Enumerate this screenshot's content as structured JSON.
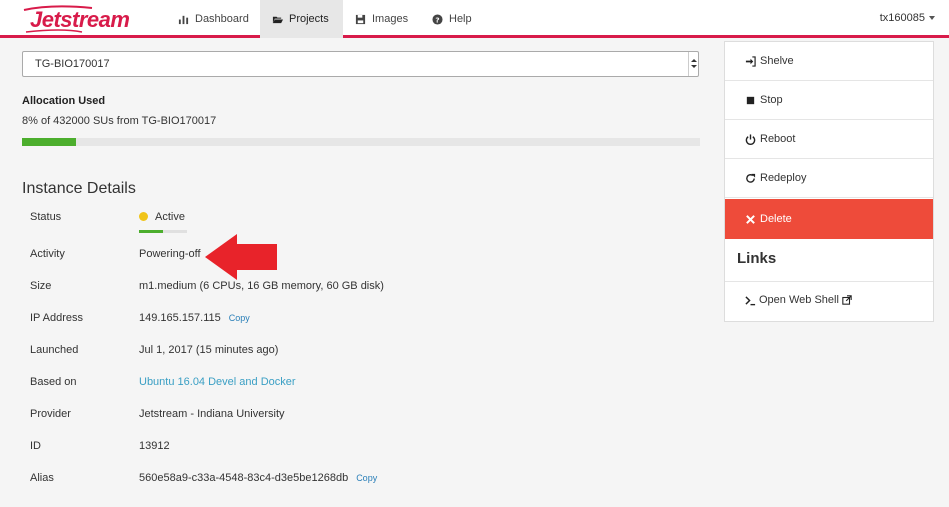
{
  "nav": {
    "logo_text": "Jetstream",
    "items": [
      {
        "label": "Dashboard",
        "icon": "bar-chart-icon"
      },
      {
        "label": "Projects",
        "icon": "folder-open-icon",
        "active": true
      },
      {
        "label": "Images",
        "icon": "floppy-disk-icon"
      },
      {
        "label": "Help",
        "icon": "question-circle-icon"
      }
    ],
    "user": "tx160085"
  },
  "allocation_source": {
    "selected": "TG-BIO170017"
  },
  "allocation": {
    "title": "Allocation Used",
    "text": "8% of 432000 SUs from TG-BIO170017",
    "percent_used": 8
  },
  "instance": {
    "section_title": "Instance Details",
    "rows": [
      {
        "label": "Status",
        "value": "Active"
      },
      {
        "label": "Activity",
        "value": "Powering-off"
      },
      {
        "label": "Size",
        "value": "m1.medium (6 CPUs, 16 GB memory, 60 GB disk)"
      },
      {
        "label": "IP Address",
        "value": "149.165.157.115",
        "copy": "Copy"
      },
      {
        "label": "Launched",
        "value": "Jul 1, 2017 (15 minutes ago)"
      },
      {
        "label": "Based on",
        "value": "Ubuntu 16.04 Devel and Docker"
      },
      {
        "label": "Provider",
        "value": "Jetstream - Indiana University"
      },
      {
        "label": "ID",
        "value": "13912"
      },
      {
        "label": "Alias",
        "value": "560e58a9-c33a-4548-83c4-d3e5be1268db",
        "copy": "Copy"
      }
    ]
  },
  "actions": {
    "shelve": "Shelve",
    "stop": "Stop",
    "reboot": "Reboot",
    "redeploy": "Redeploy",
    "delete": "Delete"
  },
  "links": {
    "title": "Links",
    "web_shell": "Open Web Shell"
  },
  "colors": {
    "brand": "#d81b4a",
    "progress": "#4cae2d",
    "delete": "#ee4b3a",
    "status_active": "#f0c419",
    "link": "#3a9fc4",
    "arrow": "#e8232a"
  }
}
